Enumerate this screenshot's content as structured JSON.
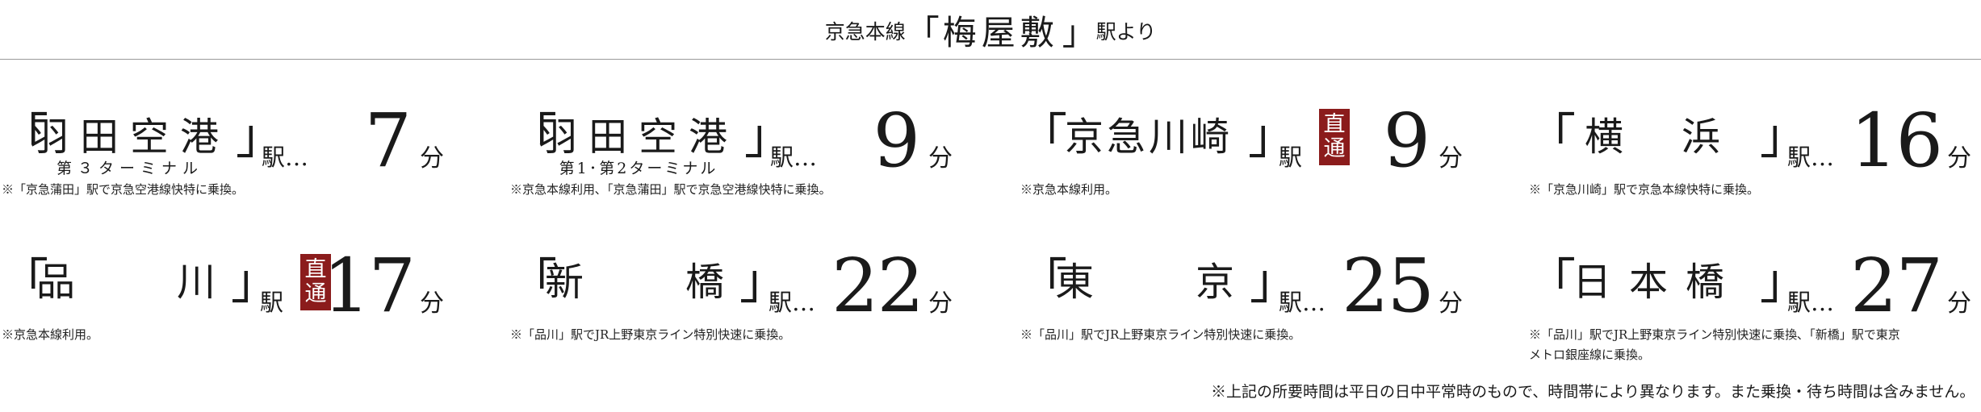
{
  "header": {
    "prefix": "京急本線",
    "open_bracket": "「",
    "station": "梅屋敷",
    "close_bracket": "」",
    "suffix": "駅より"
  },
  "routes": [
    {
      "station": "羽田空港",
      "sub": "第３ターミナル",
      "eki": "駅",
      "dots": "…",
      "badge": [
        "",
        ""
      ],
      "minutes": "7",
      "unit": "分",
      "note": [
        "※「京急蒲田」駅で京急空港線快特に乗換。"
      ]
    },
    {
      "station": "羽田空港",
      "sub": "第1･第2ターミナル",
      "eki": "駅",
      "dots": "…",
      "badge": [
        "",
        ""
      ],
      "minutes": "9",
      "unit": "分",
      "note": [
        "※京急本線利用､「京急蒲田」駅で京急空港線快特に乗換。"
      ]
    },
    {
      "station": "京急川崎",
      "sub": "",
      "eki": "駅",
      "dots": "",
      "badge": [
        "直",
        "通"
      ],
      "minutes": "9",
      "unit": "分",
      "note": [
        "※京急本線利用。"
      ]
    },
    {
      "station": "横　浜",
      "sub": "",
      "eki": "駅",
      "dots": "…",
      "badge": [
        "",
        ""
      ],
      "minutes": "16",
      "unit": "分",
      "note": [
        "※「京急川崎」駅で京急本線快特に乗換。"
      ]
    },
    {
      "station": "品　　川",
      "sub": "",
      "eki": "駅",
      "dots": "",
      "badge": [
        "直",
        "通"
      ],
      "minutes": "17",
      "unit": "分",
      "note": [
        "※京急本線利用。"
      ]
    },
    {
      "station": "新　　橋",
      "sub": "",
      "eki": "駅",
      "dots": "…",
      "badge": [
        "",
        ""
      ],
      "minutes": "22",
      "unit": "分",
      "note": [
        "※「品川」駅でJR上野東京ライン特別快速に乗換。"
      ]
    },
    {
      "station": "東　　京",
      "sub": "",
      "eki": "駅",
      "dots": "…",
      "badge": [
        "",
        ""
      ],
      "minutes": "25",
      "unit": "分",
      "note": [
        "※「品川」駅でJR上野東京ライン特別快速に乗換。"
      ]
    },
    {
      "station": "日本橋",
      "sub": "",
      "eki": "駅",
      "dots": "…",
      "badge": [
        "",
        ""
      ],
      "minutes": "27",
      "unit": "分",
      "note": [
        "※「品川」駅でJR上野東京ライン特別快速に乗換､「新橋」駅で東京",
        "メトロ銀座線に乗換。"
      ]
    }
  ],
  "footnote": "※上記の所要時間は平日の日中平常時のもので、時間帯により異なります。また乗換・待ち時間は含みません。",
  "colors": {
    "badge": "#8b1c1c",
    "text": "#1a1a1a",
    "rule": "#9a9a9a"
  }
}
